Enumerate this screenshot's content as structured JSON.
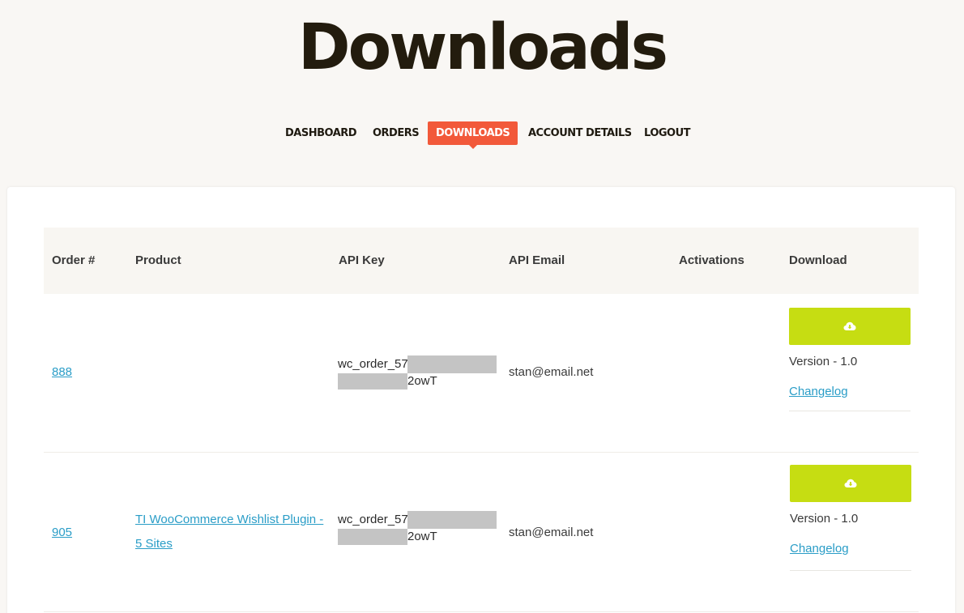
{
  "page": {
    "title": "Downloads"
  },
  "nav": {
    "items": [
      {
        "label": "DASHBOARD",
        "active": false
      },
      {
        "label": "ORDERS",
        "active": false
      },
      {
        "label": "DOWNLOADS",
        "active": true
      },
      {
        "label": "ACCOUNT DETAILS",
        "active": false
      },
      {
        "label": "LOGOUT",
        "active": false
      }
    ]
  },
  "table": {
    "headers": {
      "order": "Order #",
      "product": "Product",
      "api_key": "API Key",
      "api_email": "API Email",
      "activations": "Activations",
      "download": "Download"
    },
    "rows": [
      {
        "order": "888",
        "product_line1": "",
        "product_line2": "",
        "api_key_start": "wc_order_57",
        "api_key_end": "2owT",
        "api_email": "stan@email.net",
        "activations": "",
        "version": "Version - 1.0",
        "changelog": "Changelog"
      },
      {
        "order": "905",
        "product_line1": "TI WooCommerce Wishlist Plugin -",
        "product_line2": "5 Sites",
        "api_key_start": "wc_order_57",
        "api_key_end": "2owT",
        "api_email": "stan@email.net",
        "activations": "",
        "version": "Version - 1.0",
        "changelog": "Changelog"
      }
    ]
  },
  "icons": {
    "download": "cloud-download-icon"
  },
  "colors": {
    "accent": "#f2593a",
    "download_button": "#c6dd12",
    "link": "#2a9dc7",
    "heading": "#231c0e",
    "background": "#f9f7f4"
  }
}
